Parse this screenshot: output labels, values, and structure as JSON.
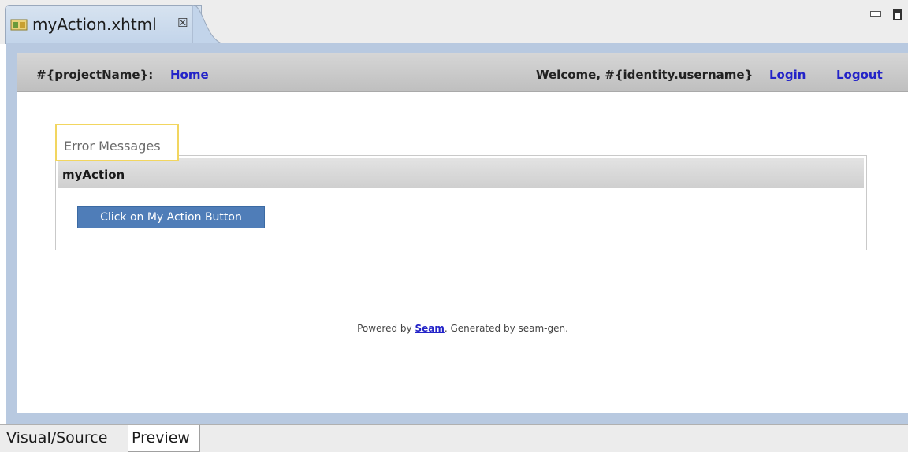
{
  "editor": {
    "tab_title": "myAction.xhtml",
    "tab_close_glyph": "☒",
    "tab_icon": "xhtml-file-icon",
    "window_controls": [
      "minimize-icon",
      "maximize-icon"
    ]
  },
  "header": {
    "project_name": "#{projectName}:",
    "home_link": "Home",
    "welcome_text": "Welcome, #{identity.username}",
    "login_link": "Login",
    "logout_link": "Logout"
  },
  "error_messages": {
    "label": "Error Messages"
  },
  "panel": {
    "title": "myAction",
    "button_label": "Click on My Action Button"
  },
  "footer": {
    "prefix": "Powered by ",
    "link": "Seam",
    "suffix": ". Generated by seam-gen."
  },
  "bottom_tabs": {
    "visual_source": "Visual/Source",
    "preview": "Preview",
    "active": "Preview"
  },
  "colors": {
    "tab_gradient": "#c2d4ea",
    "button": "#4f7db8",
    "link": "#2323c8",
    "highlight_border": "#f2d660"
  }
}
